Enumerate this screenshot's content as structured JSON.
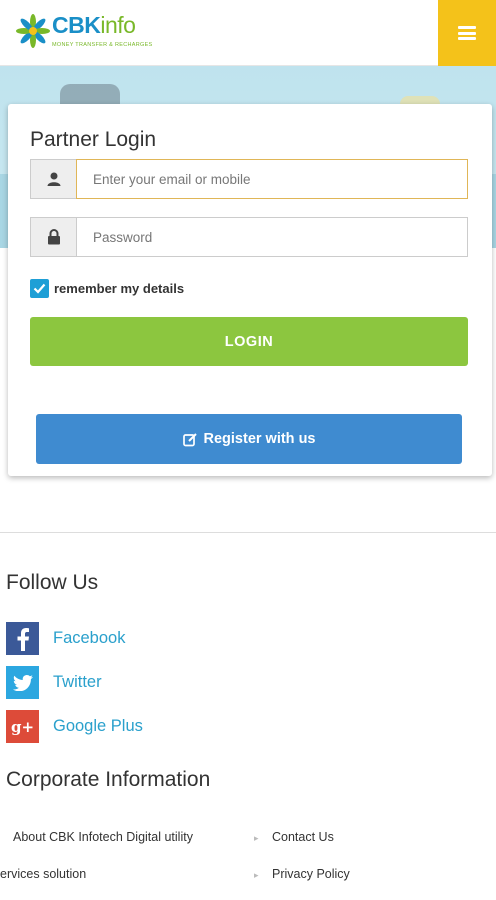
{
  "header": {
    "logo_cbk": "CBK",
    "logo_info": "info",
    "logo_tagline": "MONEY TRANSFER & RECHARGES",
    "menu_icon": "hamburger-icon",
    "accent_color": "#f4c21a"
  },
  "login": {
    "title": "Partner Login",
    "email_placeholder": "Enter your email or mobile",
    "email_value": "",
    "password_placeholder": "Password",
    "password_value": "",
    "remember_label": "remember my details",
    "remember_checked": true,
    "login_label": "LOGIN",
    "register_label": "Register with us",
    "user_icon": "user-icon",
    "lock_icon": "lock-icon",
    "edit_icon": "edit-icon",
    "login_color": "#8cc63f",
    "register_color": "#3f8bd0"
  },
  "follow": {
    "title": "Follow Us",
    "items": [
      {
        "label": "Facebook",
        "icon": "facebook-icon"
      },
      {
        "label": "Twitter",
        "icon": "twitter-icon"
      },
      {
        "label": "Google Plus",
        "icon": "google-plus-icon"
      }
    ]
  },
  "corporate": {
    "title": "Corporate Information",
    "links": [
      "About CBK Infotech Digital utility",
      "Contact Us",
      "ervices solution",
      "Privacy Policy"
    ]
  }
}
